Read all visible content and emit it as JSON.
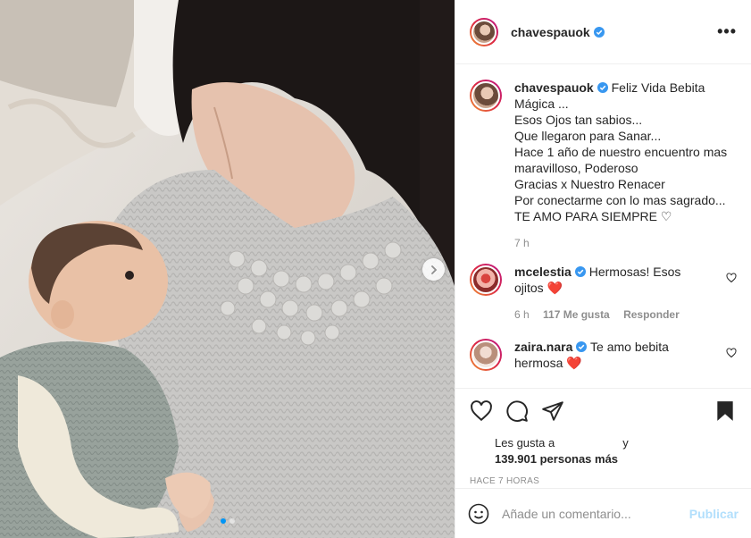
{
  "post": {
    "author": "chavespauok",
    "caption": {
      "username": "chavespauok",
      "lines": [
        "Feliz Vida Bebita",
        "Mágica ...",
        "Esos Ojos tan sabios...",
        "Que llegaron para Sanar...",
        "Hace 1 año de nuestro encuentro mas",
        "maravilloso, Poderoso",
        "Gracias x Nuestro Renacer",
        "Por conectarme con lo mas sagrado...",
        "TE AMO PARA SIEMPRE ♡"
      ],
      "time": "7 h"
    },
    "comments": [
      {
        "username": "mcelestia",
        "text_line1": "Hermosas! Esos",
        "text_line2": "ojitos ❤️",
        "time": "6 h",
        "likes": "117 Me gusta",
        "reply": "Responder"
      },
      {
        "username": "zaira.nara",
        "text_line1": "Te amo bebita",
        "text_line2": "hermosa ❤️"
      }
    ],
    "likes_prefix": "Les gusta a",
    "likes_suffix": "y",
    "likes_count": "139.901 personas más",
    "posted_ago": "HACE 7 HORAS",
    "comment_placeholder": "Añade un comentario...",
    "publish_label": "Publicar",
    "more_label": "•••"
  },
  "carousel": {
    "current": 1,
    "total": 2
  },
  "colors": {
    "verified": "#3897f0",
    "heart": "#ed4956",
    "publish": "#b2dffc",
    "active_dot": "#0095f6"
  }
}
